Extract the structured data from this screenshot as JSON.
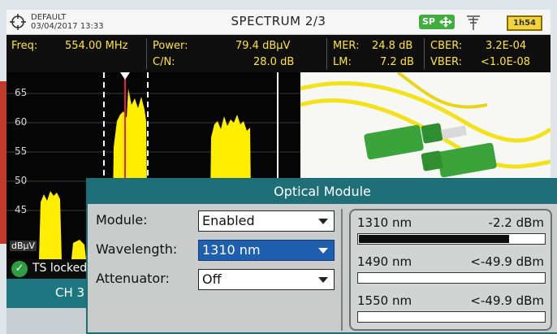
{
  "header": {
    "profile": "DEFAULT",
    "datetime": "03/04/2017 13:33",
    "title": "SPECTRUM 2/3",
    "sp_badge": "SP",
    "battery": "1h54"
  },
  "measurements": {
    "freq_label": "Freq:",
    "freq_value": "554.00 MHz",
    "power_label": "Power:",
    "power_value": "79.4 dBµV",
    "cn_label": "C/N:",
    "cn_value": "28.0 dB",
    "mer_label": "MER:",
    "mer_value": "24.8 dB",
    "lm_label": "LM:",
    "lm_value": "7.2 dB",
    "cber_label": "CBER:",
    "cber_value": "3.2E-04",
    "vber_label": "VBER:",
    "vber_value": "<1.0E-08"
  },
  "spectrum": {
    "y_ticks": [
      "65",
      "60",
      "55",
      "50",
      "45"
    ],
    "unit": "dBµV"
  },
  "status": {
    "ts_text": "TS locked",
    "channel": "CH 3"
  },
  "optical": {
    "title": "Optical Module",
    "module_label": "Module:",
    "module_value": "Enabled",
    "wavelength_label": "Wavelength:",
    "wavelength_value": "1310 nm",
    "attenuator_label": "Attenuator:",
    "attenuator_value": "Off",
    "readings": [
      {
        "wavelength": "1310 nm",
        "power": "-2.2 dBm",
        "level": 0.82
      },
      {
        "wavelength": "1490 nm",
        "power": "<-49.9 dBm",
        "level": 0
      },
      {
        "wavelength": "1550 nm",
        "power": "<-49.9 dBm",
        "level": 0
      }
    ]
  },
  "colors": {
    "accent": "#1f6f79",
    "meas_text": "#ffe33a",
    "spectrum_fill": "#ffee00",
    "selected": "#1f5fb0"
  }
}
